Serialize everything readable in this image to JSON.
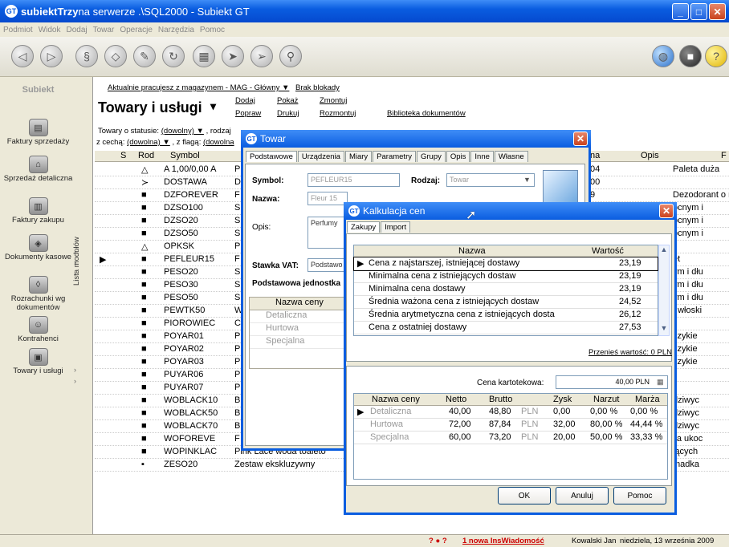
{
  "window": {
    "title_app": "subiektTrzy",
    "title_rest": " na serwerze .\\SQL2000 - Subiekt GT"
  },
  "menu": [
    "Podmiot",
    "Widok",
    "Dodaj",
    "Towar",
    "Operacje",
    "Narzędzia",
    "Pomoc"
  ],
  "nav": {
    "logo": "Subiekt",
    "items": [
      "Faktury sprzedaży",
      "Sprzedaż detaliczna",
      "Faktury zakupu",
      "Dokumenty kasowe",
      "Rozrachunki wg dokumentów",
      "Kontrahenci",
      "Towary i usługi"
    ],
    "modules_label": "Lista modułów"
  },
  "header": {
    "warehouse_link": "Aktualnie pracujesz z magazynem - MAG - Główny ▼",
    "lock_link": "Brak blokady",
    "page_title": "Towary i usługi",
    "actions": [
      "Dodaj",
      "Pokaż",
      "Zmontuj",
      "Popraw",
      "Drukuj",
      "Rozmontuj"
    ],
    "library_link": "Biblioteka dokumentów",
    "filter1_label": "Towary o statusie:",
    "filter1_value": "(dowolny) ▼",
    "filter1_tail": ", rodzaj",
    "filter2_label": "z cechą:",
    "filter2_value": "(dowolna) ▼",
    "filter2_mid": ", z flagą:",
    "filter2_value2": "(dowolna"
  },
  "grid": {
    "columns": [
      "S",
      "Rod",
      "Symbol",
      "na",
      "Opis",
      "F"
    ],
    "rows": [
      {
        "rod": "△",
        "symbol": "A 1,00/0,00 A",
        "c": "P",
        "na": "04",
        "opis": "Paleta duża"
      },
      {
        "rod": "≻",
        "symbol": "DOSTAWA",
        "c": "D",
        "na": "00",
        "opis": ""
      },
      {
        "rod": "■",
        "symbol": "DZFOREVER",
        "c": "F",
        "na": "9",
        "opis": "Dezodorant o miłym leś"
      },
      {
        "rod": "■",
        "symbol": "DZSO100",
        "c": "S",
        "na": "",
        "opis": "ocnym i"
      },
      {
        "rod": "■",
        "symbol": "DZSO20",
        "c": "S",
        "na": "",
        "opis": "ocnym i"
      },
      {
        "rod": "■",
        "symbol": "DZSO50",
        "c": "S",
        "na": "",
        "opis": "ocnym i"
      },
      {
        "rod": "△",
        "symbol": "OPKSK",
        "c": "P",
        "na": "",
        "opis": ""
      },
      {
        "rod": "■",
        "symbol": "PEFLEUR15",
        "c": "F",
        "na": "",
        "opis": "et",
        "selected": true
      },
      {
        "rod": "■",
        "symbol": "PESO20",
        "c": "S",
        "na": "",
        "opis": "ym i dłu"
      },
      {
        "rod": "■",
        "symbol": "PESO30",
        "c": "S",
        "na": "",
        "opis": "ym i dłu"
      },
      {
        "rod": "■",
        "symbol": "PESO50",
        "c": "S",
        "na": "",
        "opis": "ym i dłu"
      },
      {
        "rod": "■",
        "symbol": "PEWTK50",
        "c": "W",
        "na": "",
        "opis": "t włoski"
      },
      {
        "rod": "■",
        "symbol": "PIOROWIEC",
        "c": "C",
        "na": "",
        "opis": ""
      },
      {
        "rod": "■",
        "symbol": "POYAR01",
        "c": "P",
        "na": "",
        "opis": "czykie"
      },
      {
        "rod": "■",
        "symbol": "POYAR02",
        "c": "P",
        "na": "",
        "opis": "czykie"
      },
      {
        "rod": "■",
        "symbol": "POYAR03",
        "c": "P",
        "na": "",
        "opis": "czykie"
      },
      {
        "rod": "■",
        "symbol": "PUYAR06",
        "c": "P",
        "na": "",
        "opis": ""
      },
      {
        "rod": "■",
        "symbol": "PUYAR07",
        "c": "P",
        "na": "",
        "opis": ""
      },
      {
        "rod": "■",
        "symbol": "WOBLACK10",
        "c": "B",
        "na": "",
        "opis": "dziwyc"
      },
      {
        "rod": "■",
        "symbol": "WOBLACK50",
        "c": "B",
        "na": "",
        "opis": "dziwyc"
      },
      {
        "rod": "■",
        "symbol": "WOBLACK70",
        "c": "B",
        "na": "",
        "opis": "dziwyc"
      },
      {
        "rod": "■",
        "symbol": "WOFOREVE",
        "c": "F",
        "na": "",
        "opis": "lla ukoc"
      },
      {
        "rod": "■",
        "symbol": "WOPINKLAC",
        "c": "Pink Lace woda toaleto",
        "na": "",
        "opis": "jących"
      },
      {
        "rod": "▪",
        "symbol": "ZESO20",
        "c": "Zestaw ekskluzywny",
        "na": "",
        "opis": "madka"
      }
    ]
  },
  "status": {
    "notice": "1 nowa InsWiadomość",
    "user": "Kowalski Jan",
    "date": "niedziela, 13 września 2009"
  },
  "towar": {
    "title": "Towar",
    "tabs": [
      "Podstawowe",
      "Urządzenia",
      "Miary",
      "Parametry",
      "Grupy",
      "Opis",
      "Inne",
      "Własne"
    ],
    "symbol_label": "Symbol:",
    "symbol_value": "PEFLEUR15",
    "rodzaj_label": "Rodzaj:",
    "rodzaj_value": "Towar",
    "nazwa_label": "Nazwa:",
    "nazwa_value": "Fleur 15",
    "opis_label": "Opis:",
    "opis_value": "Perfumy",
    "vat_label": "Stawka VAT:",
    "vat_value": "Podstawo",
    "unit_label": "Podstawowa jednostka",
    "price_header": "Nazwa ceny",
    "price_names": [
      "Detaliczna",
      "Hurtowa",
      "Specjalna"
    ]
  },
  "kalk": {
    "title": "Kalkulacja cen",
    "tabs": [
      "Zakupy",
      "Import"
    ],
    "col_name": "Nazwa",
    "col_value": "Wartość",
    "rows": [
      {
        "name": "Cena z najstarszej, istniejącej dostawy",
        "value": "23,19"
      },
      {
        "name": "Minimalna cena z istniejących dostaw",
        "value": "23,19"
      },
      {
        "name": "Minimalna cena dostawy",
        "value": "23,19"
      },
      {
        "name": "Średnia ważona cena z istniejących dostaw",
        "value": "24,52"
      },
      {
        "name": "Średnia arytmetyczna cena z istniejących dosta",
        "value": "26,12"
      },
      {
        "name": "Cena z ostatniej dostawy",
        "value": "27,53"
      }
    ],
    "transfer_link": "Przenieś wartość: 0 PLN",
    "card_price_label": "Cena kartotekowa:",
    "card_price_value": "40,00 PLN",
    "price_cols": [
      "Nazwa ceny",
      "Netto",
      "Brutto",
      "Zysk",
      "Narzut",
      "Marża"
    ],
    "prices": [
      {
        "name": "Detaliczna",
        "netto": "40,00",
        "brutto": "48,80",
        "cur": "PLN",
        "zysk": "0,00",
        "narzut": "0,00 %",
        "marza": "0,00 %"
      },
      {
        "name": "Hurtowa",
        "netto": "72,00",
        "brutto": "87,84",
        "cur": "PLN",
        "zysk": "32,00",
        "narzut": "80,00 %",
        "marza": "44,44 %"
      },
      {
        "name": "Specjalna",
        "netto": "60,00",
        "brutto": "73,20",
        "cur": "PLN",
        "zysk": "20,00",
        "narzut": "50,00 %",
        "marza": "33,33 %"
      }
    ],
    "ok": "OK",
    "cancel": "Anuluj",
    "help": "Pomoc"
  }
}
